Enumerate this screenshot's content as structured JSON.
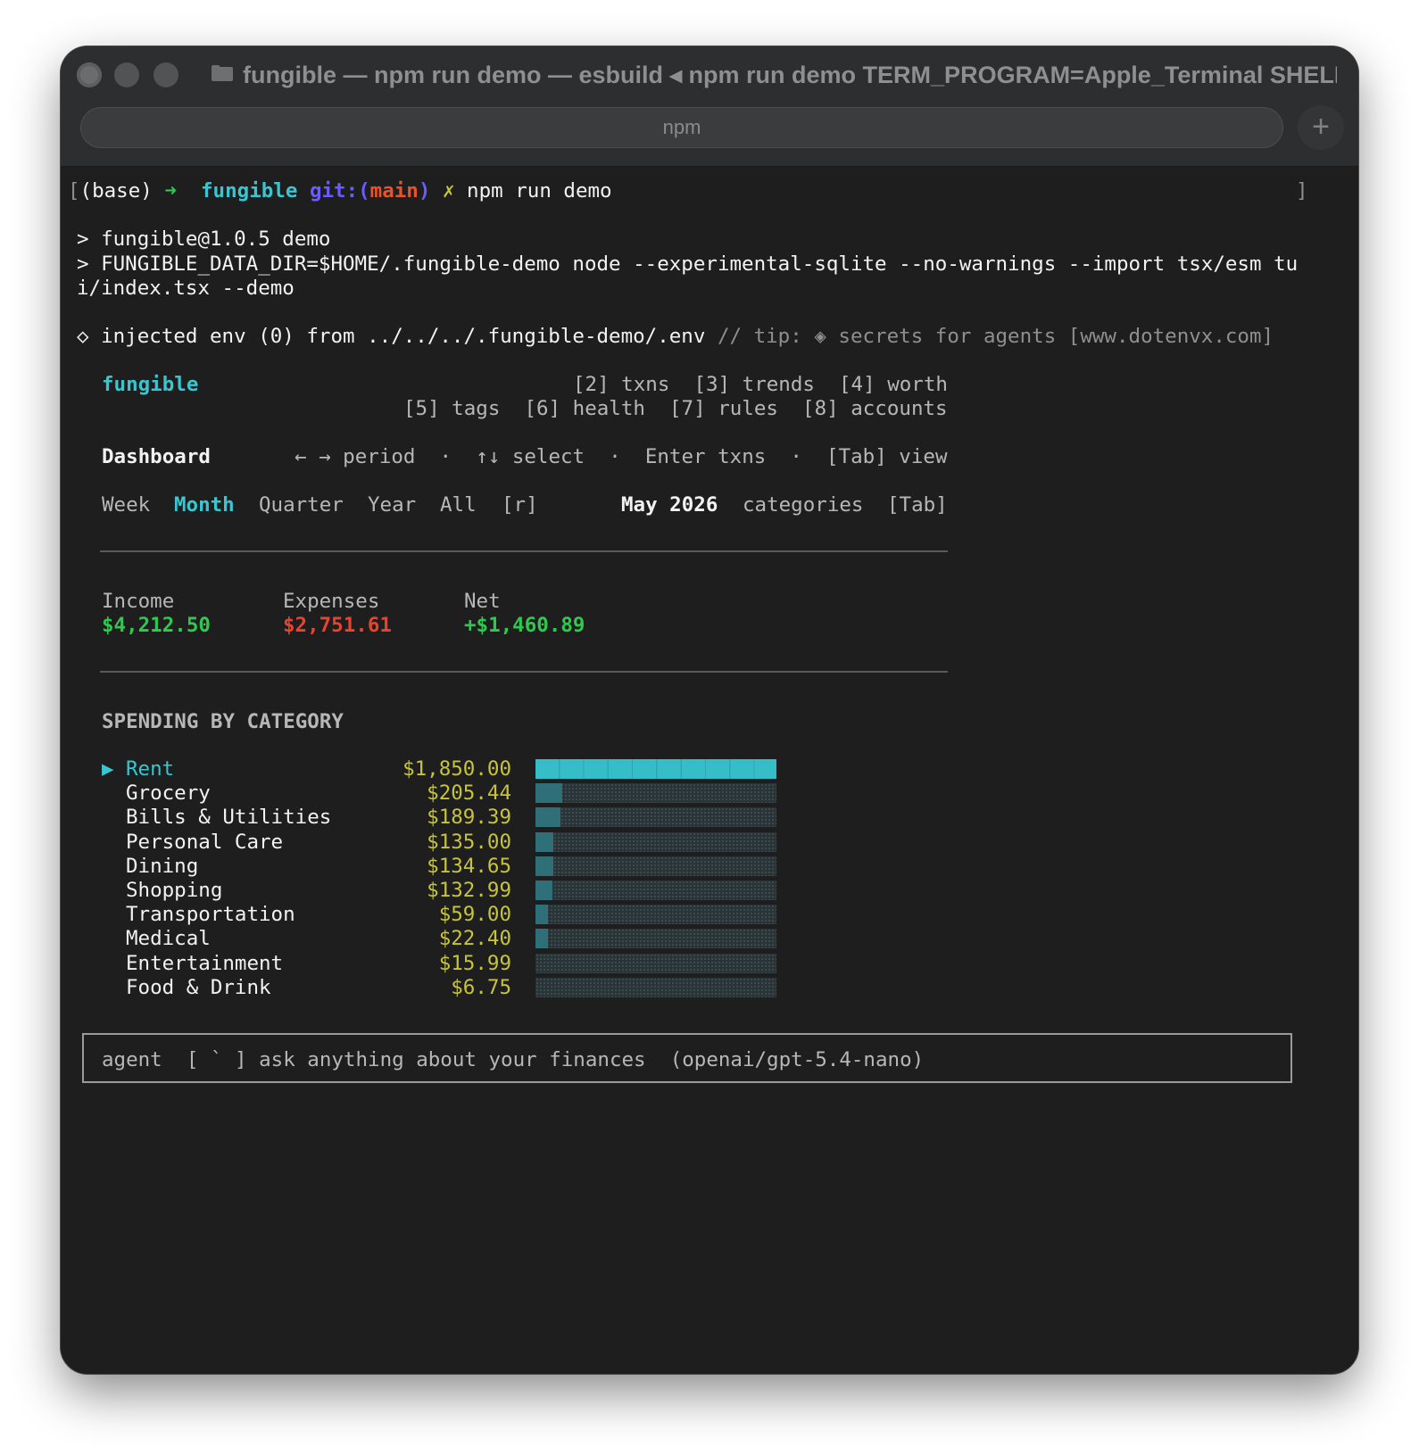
{
  "window": {
    "title": "fungible — npm run demo — esbuild ◂ npm run demo TERM_PROGRAM=Apple_Terminal SHELL=...",
    "tab": "npm",
    "new_tab_icon": "plus-icon"
  },
  "prompt": {
    "bracket_open": "[",
    "env": "(base)",
    "arrow": "➜",
    "dir": "fungible",
    "git_label": "git:(",
    "branch": "main",
    "git_close": ")",
    "dirty_mark": "✗",
    "command": "npm run demo",
    "bracket_close": "]"
  },
  "output": {
    "line1": "> fungible@1.0.5 demo",
    "line2": "> FUNGIBLE_DATA_DIR=$HOME/.fungible-demo node --experimental-sqlite --no-warnings --import tsx/esm tu",
    "line3": "i/index.tsx --demo",
    "env_main": "◇ injected env (0) from ../../../.fungible-demo/.env",
    "env_tip": " // tip: ◈ secrets for agents [www.dotenvx.com]"
  },
  "app": {
    "name": "fungible",
    "nav_row1": "[2] txns  [3] trends  [4] worth",
    "nav_row2": "[5] tags  [6] health  [7] rules  [8] accounts",
    "view_title": "Dashboard",
    "hints": "← → period  ·  ↑↓ select  ·  Enter txns  ·  [Tab] view",
    "periods": [
      "Week",
      "Month",
      "Quarter",
      "Year",
      "All"
    ],
    "active_period": "Month",
    "refresh_key": "[r]",
    "current_period": "May 2026",
    "categories_label": "categories",
    "categories_key": "[Tab]"
  },
  "summary": {
    "income_label": "Income",
    "income_value": "$4,212.50",
    "expenses_label": "Expenses",
    "expenses_value": "$2,751.61",
    "net_label": "Net",
    "net_value": "+$1,460.89"
  },
  "spending": {
    "heading": "SPENDING BY CATEGORY",
    "selected_marker": "▶",
    "selected_index": 0
  },
  "chart_data": {
    "type": "bar",
    "title": "SPENDING BY CATEGORY",
    "categories": [
      "Rent",
      "Grocery",
      "Bills & Utilities",
      "Personal Care",
      "Dining",
      "Shopping",
      "Transportation",
      "Medical",
      "Entertainment",
      "Food & Drink"
    ],
    "labels": [
      "$1,850.00",
      "$205.44",
      "$189.39",
      "$135.00",
      "$134.65",
      "$132.99",
      "$59.00",
      "$22.40",
      "$15.99",
      "$6.75"
    ],
    "values": [
      1850.0,
      205.44,
      189.39,
      135.0,
      134.65,
      132.99,
      59.0,
      22.4,
      15.99,
      6.75
    ],
    "orientation": "horizontal"
  },
  "agent": {
    "label": "agent",
    "key": "[ ` ]",
    "placeholder": "ask anything about your finances",
    "model": "(openai/gpt-5.4-nano)"
  },
  "colors": {
    "accent_cyan": "#39c6d0",
    "income_green": "#2fc94f",
    "expense_red": "#e8432f",
    "amount_yellow": "#c7c43a",
    "terminal_bg": "#1e1e1e"
  }
}
